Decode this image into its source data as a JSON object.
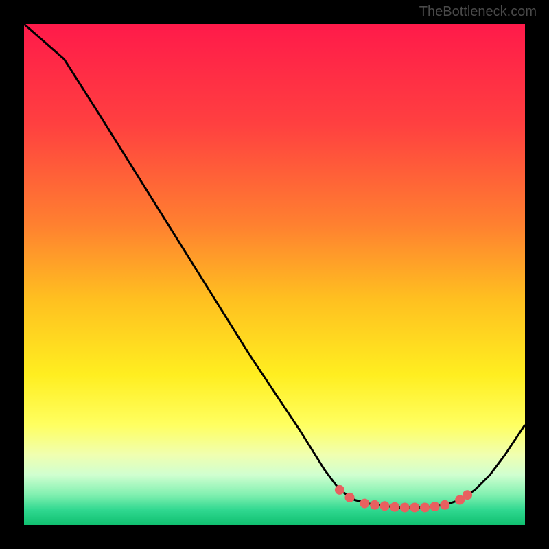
{
  "attribution": "TheBottleneck.com",
  "chart_data": {
    "type": "line",
    "title": "",
    "xlabel": "",
    "ylabel": "",
    "xlim": [
      0,
      100
    ],
    "ylim": [
      0,
      100
    ],
    "gradient_stops": [
      {
        "offset": 0,
        "color": "#ff1a4a"
      },
      {
        "offset": 20,
        "color": "#ff4040"
      },
      {
        "offset": 40,
        "color": "#ff8030"
      },
      {
        "offset": 55,
        "color": "#ffc020"
      },
      {
        "offset": 70,
        "color": "#ffee20"
      },
      {
        "offset": 80,
        "color": "#ffff60"
      },
      {
        "offset": 86,
        "color": "#f0ffb0"
      },
      {
        "offset": 90,
        "color": "#d0ffd0"
      },
      {
        "offset": 94,
        "color": "#80f0b0"
      },
      {
        "offset": 97,
        "color": "#30d890"
      },
      {
        "offset": 100,
        "color": "#10c070"
      }
    ],
    "curve": [
      {
        "x": 0,
        "y": 100
      },
      {
        "x": 8,
        "y": 93
      },
      {
        "x": 15,
        "y": 82
      },
      {
        "x": 25,
        "y": 66
      },
      {
        "x": 35,
        "y": 50
      },
      {
        "x": 45,
        "y": 34
      },
      {
        "x": 55,
        "y": 19
      },
      {
        "x": 60,
        "y": 11
      },
      {
        "x": 63,
        "y": 7
      },
      {
        "x": 66,
        "y": 5
      },
      {
        "x": 70,
        "y": 4
      },
      {
        "x": 75,
        "y": 3.5
      },
      {
        "x": 80,
        "y": 3.5
      },
      {
        "x": 84,
        "y": 4
      },
      {
        "x": 87,
        "y": 5
      },
      {
        "x": 90,
        "y": 7
      },
      {
        "x": 93,
        "y": 10
      },
      {
        "x": 96,
        "y": 14
      },
      {
        "x": 100,
        "y": 20
      }
    ],
    "markers": [
      {
        "x": 63,
        "y": 7
      },
      {
        "x": 65,
        "y": 5.5
      },
      {
        "x": 68,
        "y": 4.3
      },
      {
        "x": 70,
        "y": 4
      },
      {
        "x": 72,
        "y": 3.8
      },
      {
        "x": 74,
        "y": 3.6
      },
      {
        "x": 76,
        "y": 3.5
      },
      {
        "x": 78,
        "y": 3.5
      },
      {
        "x": 80,
        "y": 3.5
      },
      {
        "x": 82,
        "y": 3.7
      },
      {
        "x": 84,
        "y": 4
      },
      {
        "x": 87,
        "y": 5
      },
      {
        "x": 88.5,
        "y": 6
      }
    ],
    "marker_color": "#e86060",
    "marker_radius": 7
  }
}
